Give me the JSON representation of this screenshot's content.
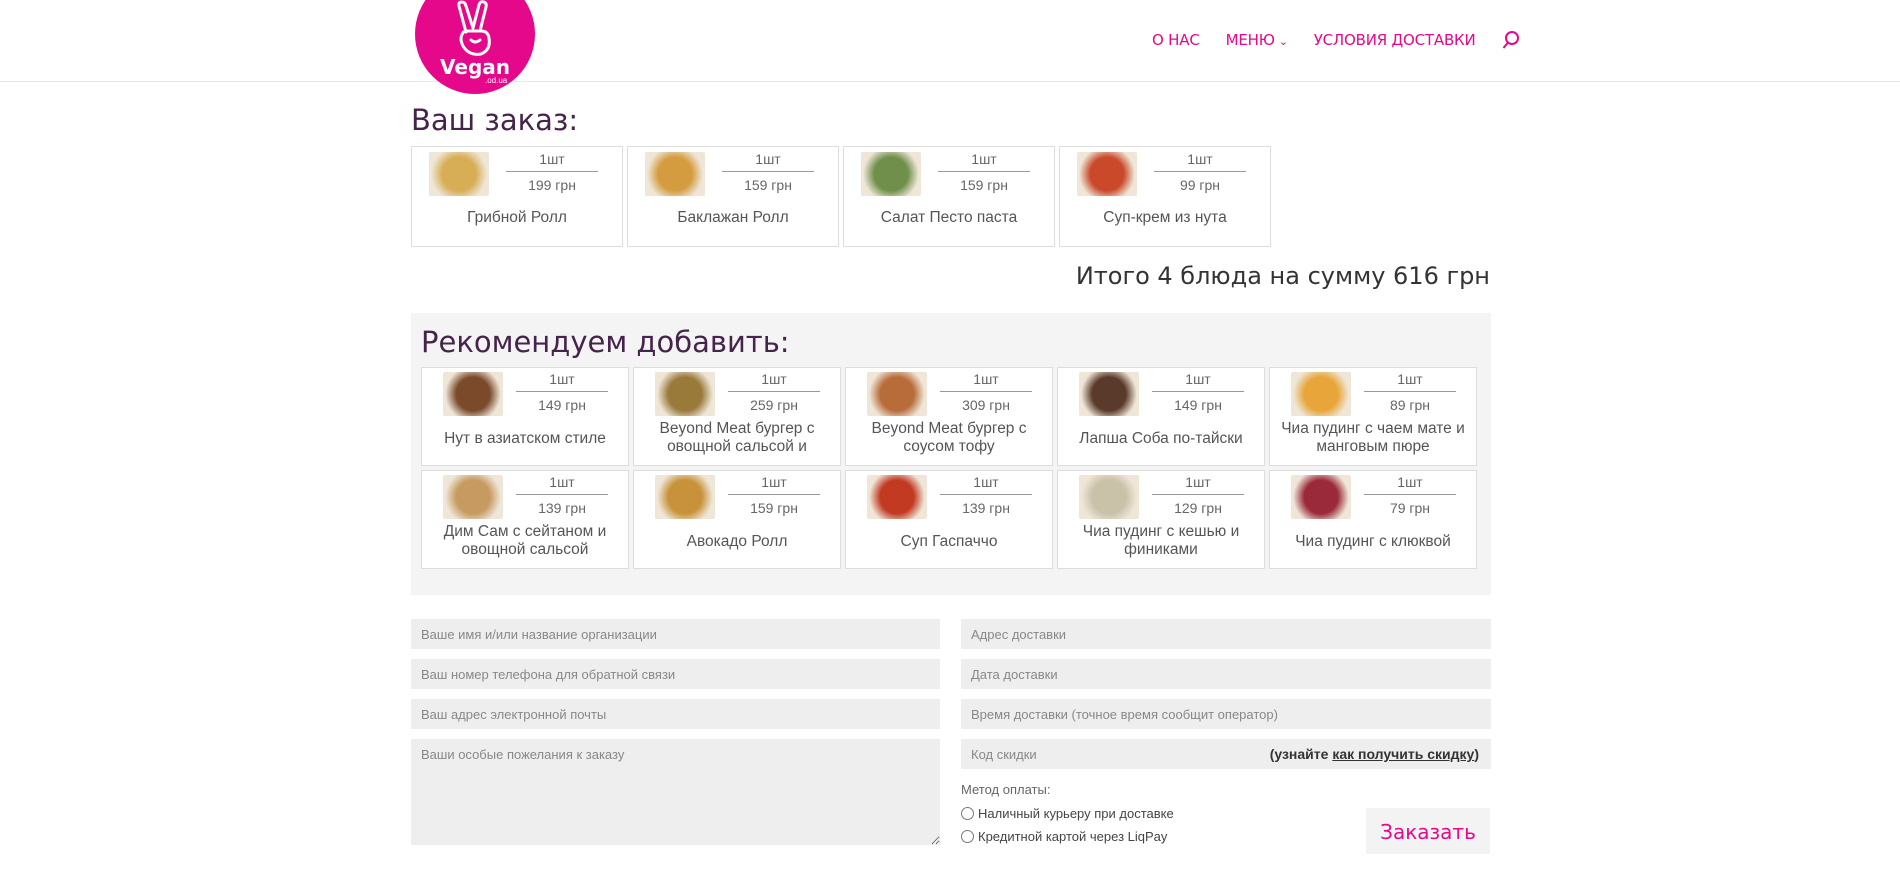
{
  "logo": {
    "brand": "Vegan",
    "domain": ".od.ua"
  },
  "nav": {
    "items": [
      "О НАС",
      "МЕНЮ",
      "УСЛОВИЯ ДОСТАВКИ"
    ]
  },
  "order": {
    "title": "Ваш заказ:",
    "items": [
      {
        "qty": "1шт",
        "price": "199 грн",
        "name": "Грибной Ролл",
        "color": "#d7ad55"
      },
      {
        "qty": "1шт",
        "price": "159 грн",
        "name": "Баклажан Ролл",
        "color": "#d49c3e"
      },
      {
        "qty": "1шт",
        "price": "159 грн",
        "name": "Салат Песто паста",
        "color": "#6f8f4a"
      },
      {
        "qty": "1шт",
        "price": "99 грн",
        "name": "Суп-крем из нута",
        "color": "#c9492a"
      }
    ],
    "total": "Итого 4 блюда на сумму 616 грн"
  },
  "recommend": {
    "title": "Рекомендуем добавить:",
    "items": [
      {
        "qty": "1шт",
        "price": "149 грн",
        "name": "Нут в азиатском стиле",
        "color": "#7a4a2a"
      },
      {
        "qty": "1шт",
        "price": "259 грн",
        "name": "Beyond Meat бургер с овощной сальсой и",
        "color": "#9a7a3a"
      },
      {
        "qty": "1шт",
        "price": "309 грн",
        "name": "Beyond Meat бургер с соусом тофу",
        "color": "#b86c3a"
      },
      {
        "qty": "1шт",
        "price": "149 грн",
        "name": "Лапша Соба по-тайски",
        "color": "#5a3a2a"
      },
      {
        "qty": "1шт",
        "price": "89 грн",
        "name": "Чиа пудинг с чаем мате и манговым пюре",
        "color": "#e8a63a"
      },
      {
        "qty": "1шт",
        "price": "139 грн",
        "name": "Дим Сам с сейтаном и овощной сальсой",
        "color": "#c79a62"
      },
      {
        "qty": "1шт",
        "price": "159 грн",
        "name": "Авокадо Ролл",
        "color": "#c8923a"
      },
      {
        "qty": "1шт",
        "price": "139 грн",
        "name": "Суп Гаспаччо",
        "color": "#c23a22"
      },
      {
        "qty": "1шт",
        "price": "129 грн",
        "name": "Чиа пудинг с кешью и финиками",
        "color": "#c9c2a8"
      },
      {
        "qty": "1шт",
        "price": "79 грн",
        "name": "Чиа пудинг с клюквой",
        "color": "#9a2a3a"
      }
    ]
  },
  "form": {
    "name_ph": "Ваше имя и/или название организации",
    "phone_ph": "Ваш номер телефона для обратной связи",
    "email_ph": "Ваш адрес электронной почты",
    "wishes_ph": "Ваши особые пожелания к заказу",
    "address_ph": "Адрес доставки",
    "date_ph": "Дата доставки",
    "time_ph": "Время доставки (точное время сообщит оператор)",
    "discount_ph": "Код скидки",
    "hint_open": "(узнайте ",
    "hint_link": "как получить скидку",
    "hint_close": ")",
    "payment_label": "Метод оплаты:",
    "payment_options": [
      "Наличный курьеру при доставке",
      "Кредитной картой через LiqPay"
    ],
    "submit": "Заказать"
  },
  "colors": {
    "accent": "#e5088a",
    "title": "#45234a"
  }
}
